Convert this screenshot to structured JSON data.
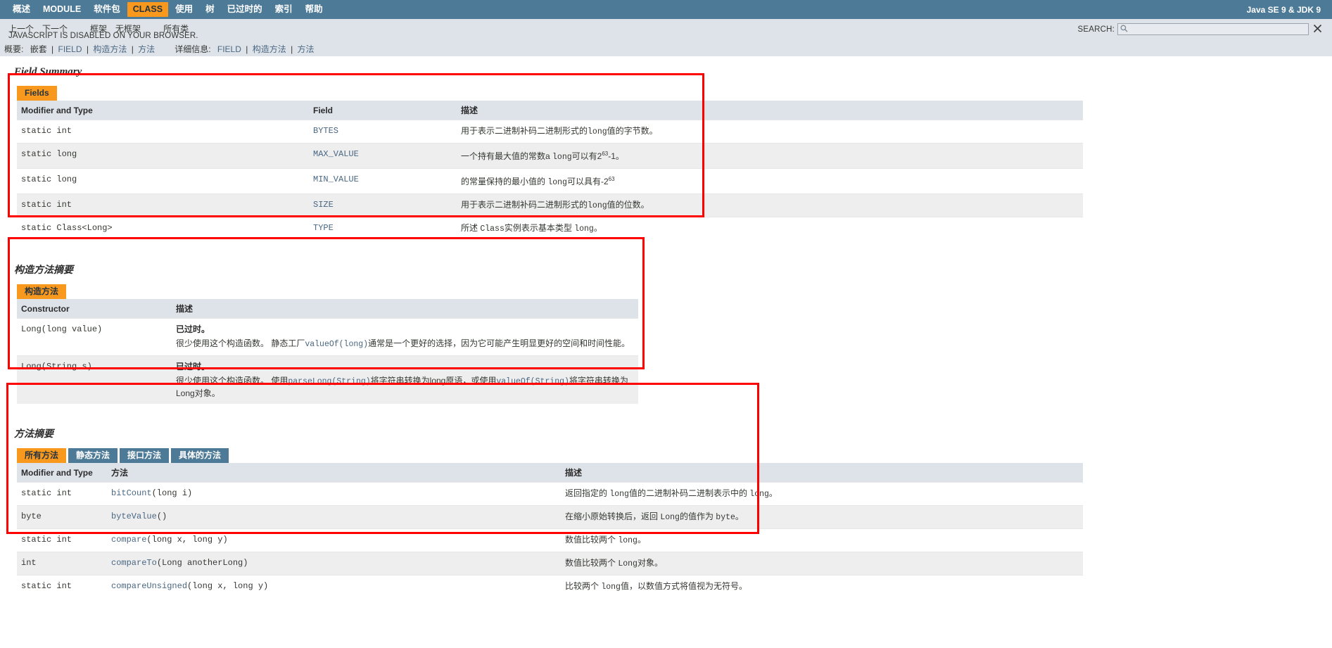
{
  "topnav": {
    "items": [
      {
        "label": "概述",
        "active": false
      },
      {
        "label": "MODULE",
        "active": false
      },
      {
        "label": "软件包",
        "active": false
      },
      {
        "label": "CLASS",
        "active": true
      },
      {
        "label": "使用",
        "active": false
      },
      {
        "label": "树",
        "active": false
      },
      {
        "label": "已过时的",
        "active": false
      },
      {
        "label": "索引",
        "active": false
      },
      {
        "label": "帮助",
        "active": false
      }
    ],
    "release": "Java SE 9 & JDK 9"
  },
  "subnav": {
    "items": [
      "上一个",
      "下一个",
      "框架",
      "无框架",
      "所有类"
    ],
    "js_note": "JAVASCRIPT IS DISABLED ON YOUR BROWSER.",
    "search_label": "SEARCH:",
    "search_value": "",
    "search_placeholder": ""
  },
  "summary_line": {
    "summary_label": "概要:",
    "summary_items": [
      "嵌套",
      "FIELD",
      "构造方法",
      "方法"
    ],
    "detail_label": "详细信息:",
    "detail_items": [
      "FIELD",
      "构造方法",
      "方法"
    ]
  },
  "field_summary": {
    "title": "Field Summary",
    "tab": "Fields",
    "headers": [
      "Modifier and Type",
      "Field",
      "描述"
    ],
    "rows": [
      {
        "type": "static int",
        "name": "BYTES",
        "desc_pre": "用于表示二进制补码二进制形式的",
        "desc_code": "long",
        "desc_post": "值的字节数。"
      },
      {
        "type": "static long",
        "name": "MAX_VALUE",
        "desc_pre": "一个持有最大值的常数a ",
        "desc_code": "long",
        "desc_post": "可以有2",
        "sup": "63",
        "desc_tail": "-1。"
      },
      {
        "type": "static long",
        "name": "MIN_VALUE",
        "desc_pre": "的常量保持的最小值的 ",
        "desc_code": "long",
        "desc_post": "可以具有-2",
        "sup": "63",
        "desc_tail": ""
      },
      {
        "type": "static int",
        "name": "SIZE",
        "desc_pre": "用于表示二进制补码二进制形式的",
        "desc_code": "long",
        "desc_post": "值的位数。"
      },
      {
        "type": "static Class<Long>",
        "name": "TYPE",
        "desc_pre": "所述 ",
        "desc_code": "Class",
        "desc_post": "实例表示基本类型 ",
        "desc_code2": "long",
        "desc_tail": "。"
      }
    ]
  },
  "constructor_summary": {
    "title": "构造方法摘要",
    "tab": "构造方法",
    "headers": [
      "Constructor",
      "描述"
    ],
    "rows": [
      {
        "signature": "Long(long value)",
        "deprecated": "已过时。",
        "desc_pre": "很少使用这个构造函数。 静态工厂",
        "desc_link": "valueOf(long)",
        "desc_post": "通常是一个更好的选择，因为它可能产生明显更好的空间和时间性能。"
      },
      {
        "signature": "Long(String s)",
        "deprecated": "已过时。",
        "desc_pre": "很少使用这个构造函数。 使用",
        "desc_link": "parseLong(String)",
        "desc_mid": "将字符串转换为long原语，或使用",
        "desc_link2": "valueOf(String)",
        "desc_post": "将字符串转换为Long对象。"
      }
    ]
  },
  "method_summary": {
    "title": "方法摘要",
    "tabs": [
      {
        "label": "所有方法",
        "active": true
      },
      {
        "label": "静态方法",
        "active": false
      },
      {
        "label": "接口方法",
        "active": false
      },
      {
        "label": "具体的方法",
        "active": false
      }
    ],
    "headers": [
      "Modifier and Type",
      "方法",
      "描述"
    ],
    "rows": [
      {
        "type": "static int",
        "name": "bitCount",
        "params": "(long i)",
        "desc_pre": "返回指定的 ",
        "desc_code": "long",
        "desc_post": "值的二进制补码二进制表示中的 ",
        "desc_code2": "long",
        "desc_tail": "。"
      },
      {
        "type": "byte",
        "name": "byteValue",
        "params": "()",
        "desc_pre": "在缩小原始转换后，返回 ",
        "desc_code": "Long",
        "desc_post": "的值作为 ",
        "desc_code2": "byte",
        "desc_tail": "。"
      },
      {
        "type": "static int",
        "name": "compare",
        "params": "(long x, long y)",
        "desc_pre": "数值比较两个 ",
        "desc_code": "long",
        "desc_post": "。"
      },
      {
        "type": "int",
        "name": "compareTo",
        "params": "(Long anotherLong)",
        "desc_pre": "数值比较两个 ",
        "desc_code": "Long",
        "desc_post": "对象。"
      },
      {
        "type": "static int",
        "name": "compareUnsigned",
        "params": "(long x, long y)",
        "desc_pre": "比较两个 ",
        "desc_code": "long",
        "desc_post": "值，以数值方式将值视为无符号。"
      }
    ]
  },
  "colors": {
    "nav_bg": "#4D7A97",
    "accent": "#F8981D",
    "link": "#4A6782",
    "annotation": "#FF0000",
    "subnav_bg": "#DEE3E9"
  }
}
